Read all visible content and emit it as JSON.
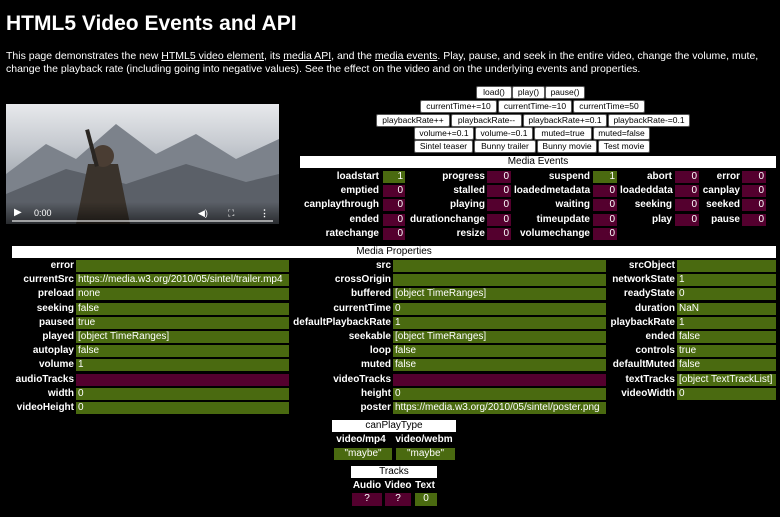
{
  "title": "HTML5 Video Events and API",
  "intro": {
    "t1": "This page demonstrates the new ",
    "l1": "HTML5 video element",
    "t2": ", its ",
    "l2": "media API",
    "t3": ", and the ",
    "l3": "media events",
    "t4": ". Play, pause, and seek in the entire video, change the volume, mute, change the playback rate (including going into negative values). See the effect on the video and on the underlying events and properties."
  },
  "player": {
    "time": "0:00",
    "play_icon": "play-icon",
    "volume_icon": "volume-icon",
    "fullscreen_icon": "fullscreen-icon",
    "menu_icon": "more-icon"
  },
  "buttons": {
    "load": "load()",
    "play": "play()",
    "pause": "pause()",
    "ct_plus10": "currentTime+=10",
    "ct_minus10": "currentTime-=10",
    "ct_50": "currentTime=50",
    "pr_plusplus": "playbackRate++",
    "pr_minusminus": "playbackRate--",
    "pr_plus01": "playbackRate+=0.1",
    "pr_minus01": "playbackRate-=0.1",
    "vol_plus": "volume+=0.1",
    "vol_minus": "volume-=0.1",
    "muted_true": "muted=true",
    "muted_false": "muted=false",
    "sintel_teaser": "Sintel teaser",
    "bunny_trailer": "Bunny trailer",
    "bunny_movie": "Bunny movie",
    "test_movie": "Test movie"
  },
  "events": {
    "header": "Media Events",
    "loadstart": {
      "label": "loadstart",
      "value": "1"
    },
    "progress": {
      "label": "progress",
      "value": "0"
    },
    "suspend": {
      "label": "suspend",
      "value": "1"
    },
    "abort": {
      "label": "abort",
      "value": "0"
    },
    "error": {
      "label": "error",
      "value": "0"
    },
    "emptied": {
      "label": "emptied",
      "value": "0"
    },
    "stalled": {
      "label": "stalled",
      "value": "0"
    },
    "loadedmetadata": {
      "label": "loadedmetadata",
      "value": "0"
    },
    "loadeddata": {
      "label": "loadeddata",
      "value": "0"
    },
    "canplay": {
      "label": "canplay",
      "value": "0"
    },
    "canplaythrough": {
      "label": "canplaythrough",
      "value": "0"
    },
    "playing": {
      "label": "playing",
      "value": "0"
    },
    "waiting": {
      "label": "waiting",
      "value": "0"
    },
    "seeking": {
      "label": "seeking",
      "value": "0"
    },
    "seeked": {
      "label": "seeked",
      "value": "0"
    },
    "ended": {
      "label": "ended",
      "value": "0"
    },
    "durationchange": {
      "label": "durationchange",
      "value": "0"
    },
    "timeupdate": {
      "label": "timeupdate",
      "value": "0"
    },
    "play": {
      "label": "play",
      "value": "0"
    },
    "pause": {
      "label": "pause",
      "value": "0"
    },
    "ratechange": {
      "label": "ratechange",
      "value": "0"
    },
    "resize": {
      "label": "resize",
      "value": "0"
    },
    "volumechange": {
      "label": "volumechange",
      "value": "0"
    }
  },
  "properties": {
    "header": "Media Properties",
    "error": {
      "label": "error",
      "value": ""
    },
    "currentSrc": {
      "label": "currentSrc",
      "value": "https://media.w3.org/2010/05/sintel/trailer.mp4"
    },
    "preload": {
      "label": "preload",
      "value": "none"
    },
    "seeking": {
      "label": "seeking",
      "value": "false"
    },
    "paused": {
      "label": "paused",
      "value": "true"
    },
    "played": {
      "label": "played",
      "value": "[object TimeRanges]"
    },
    "autoplay": {
      "label": "autoplay",
      "value": "false"
    },
    "volume": {
      "label": "volume",
      "value": "1"
    },
    "audioTracks": {
      "label": "audioTracks",
      "value": ""
    },
    "width": {
      "label": "width",
      "value": "0"
    },
    "videoHeight": {
      "label": "videoHeight",
      "value": "0"
    },
    "src": {
      "label": "src",
      "value": ""
    },
    "crossOrigin": {
      "label": "crossOrigin",
      "value": ""
    },
    "buffered": {
      "label": "buffered",
      "value": "[object TimeRanges]"
    },
    "currentTime": {
      "label": "currentTime",
      "value": "0"
    },
    "defaultPlaybackRate": {
      "label": "defaultPlaybackRate",
      "value": "1"
    },
    "seekable": {
      "label": "seekable",
      "value": "[object TimeRanges]"
    },
    "loop": {
      "label": "loop",
      "value": "false"
    },
    "muted": {
      "label": "muted",
      "value": "false"
    },
    "videoTracks": {
      "label": "videoTracks",
      "value": ""
    },
    "height": {
      "label": "height",
      "value": "0"
    },
    "poster": {
      "label": "poster",
      "value": "https://media.w3.org/2010/05/sintel/poster.png"
    },
    "srcObject": {
      "label": "srcObject",
      "value": ""
    },
    "networkState": {
      "label": "networkState",
      "value": "1"
    },
    "readyState": {
      "label": "readyState",
      "value": "0"
    },
    "duration": {
      "label": "duration",
      "value": "NaN"
    },
    "playbackRate": {
      "label": "playbackRate",
      "value": "1"
    },
    "ended": {
      "label": "ended",
      "value": "false"
    },
    "controls": {
      "label": "controls",
      "value": "true"
    },
    "defaultMuted": {
      "label": "defaultMuted",
      "value": "false"
    },
    "textTracks": {
      "label": "textTracks",
      "value": "[object TextTrackList]"
    },
    "videoWidth": {
      "label": "videoWidth",
      "value": "0"
    }
  },
  "canplay": {
    "header": "canPlayType",
    "mp4_label": "video/mp4",
    "webm_label": "video/webm",
    "mp4_value": "\"maybe\"",
    "webm_value": "\"maybe\""
  },
  "tracks": {
    "header": "Tracks",
    "audio_label": "Audio",
    "video_label": "Video",
    "text_label": "Text",
    "audio_value": "?",
    "video_value": "?",
    "text_value": "0"
  },
  "colors": {
    "green": "#4a6a10",
    "purple": "#54002e",
    "header_bg": "#ffffff"
  }
}
